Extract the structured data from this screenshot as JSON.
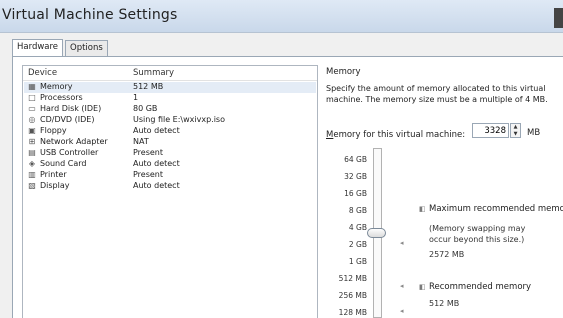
{
  "window": {
    "title": "Virtual Machine Settings"
  },
  "tabs": [
    {
      "label": "Hardware"
    },
    {
      "label": "Options"
    }
  ],
  "device_list": {
    "header_device": "Device",
    "header_summary": "Summary",
    "rows": [
      {
        "icon": "memory-icon",
        "device": "Memory",
        "summary": "512 MB"
      },
      {
        "icon": "processor-icon",
        "device": "Processors",
        "summary": "1"
      },
      {
        "icon": "hard-disk-icon",
        "device": "Hard Disk (IDE)",
        "summary": "80 GB"
      },
      {
        "icon": "cd-dvd-icon",
        "device": "CD/DVD (IDE)",
        "summary": "Using file E:\\wxivxp.iso"
      },
      {
        "icon": "floppy-icon",
        "device": "Floppy",
        "summary": "Auto detect"
      },
      {
        "icon": "network-adapter-icon",
        "device": "Network Adapter",
        "summary": "NAT"
      },
      {
        "icon": "usb-controller-icon",
        "device": "USB Controller",
        "summary": "Present"
      },
      {
        "icon": "sound-card-icon",
        "device": "Sound Card",
        "summary": "Auto detect"
      },
      {
        "icon": "printer-icon",
        "device": "Printer",
        "summary": "Present"
      },
      {
        "icon": "display-icon",
        "device": "Display",
        "summary": "Auto detect"
      }
    ]
  },
  "memory": {
    "section_label": "Memory",
    "description": "Specify the amount of memory allocated to this virtual machine. The memory size must be a multiple of 4 MB.",
    "field_label_prefix": "M",
    "field_label_rest": "emory for this virtual machine:",
    "value": "3328",
    "unit": "MB",
    "scale_labels": [
      "64 GB",
      "32 GB",
      "16 GB",
      "8 GB",
      "4 GB",
      "2 GB",
      "1 GB",
      "512 MB",
      "256 MB",
      "128 MB"
    ],
    "max_recommended_title": "Maximum recommended memo",
    "max_recommended_note_line1": "(Memory swapping may",
    "max_recommended_note_line2": "occur beyond this size.)",
    "max_recommended_value": "2572 MB",
    "recommended_title": "Recommended memory",
    "recommended_value": "512 MB"
  }
}
